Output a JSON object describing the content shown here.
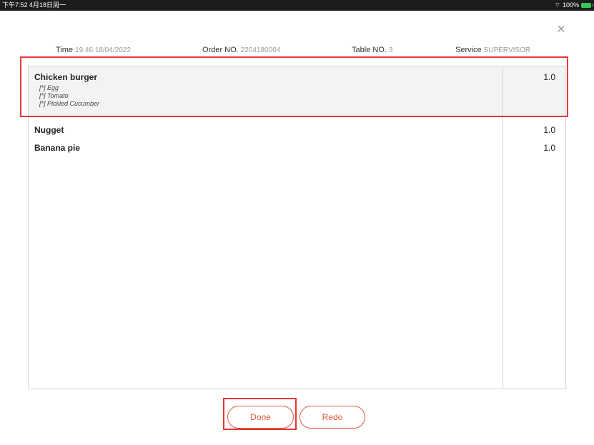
{
  "status_bar": {
    "time_date": "下午7:52  4月18日周一",
    "wifi": "✦",
    "battery_pct": "100%"
  },
  "close_icon": "×",
  "header": {
    "time_label": "Time",
    "time_value": "19:46 18/04/2022",
    "order_label": "Order NO.",
    "order_value": "2204180004",
    "table_label": "Table NO.",
    "table_value": "3",
    "service_label": "Service",
    "service_value": "SUPERVISOR"
  },
  "items": [
    {
      "name": "Chicken burger",
      "qty": "1.0",
      "modifiers": [
        "[*] Egg",
        "[*] Tomato",
        "[*] Pickled Cucumber"
      ]
    },
    {
      "name": "Nugget",
      "qty": "1.0"
    },
    {
      "name": "Banana pie",
      "qty": "1.0"
    }
  ],
  "buttons": {
    "done": "Done",
    "redo": "Redo"
  },
  "colors": {
    "accent": "#e0573a",
    "highlight": "#e53935"
  }
}
